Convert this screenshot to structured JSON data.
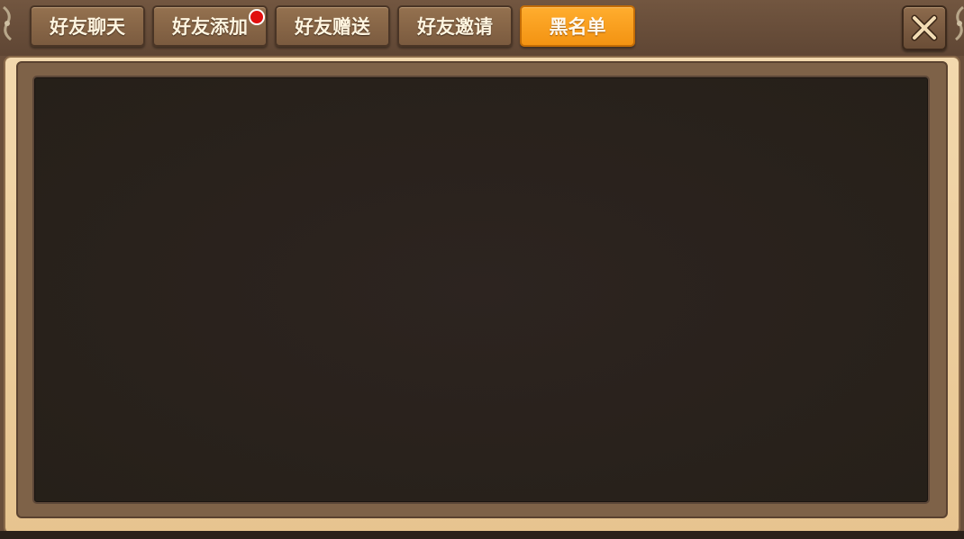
{
  "tabs": [
    {
      "label": "好友聊天",
      "active": false,
      "has_notification": false
    },
    {
      "label": "好友添加",
      "active": false,
      "has_notification": true
    },
    {
      "label": "好友赠送",
      "active": false,
      "has_notification": false
    },
    {
      "label": "好友邀请",
      "active": false,
      "has_notification": false
    },
    {
      "label": "黑名单",
      "active": true,
      "has_notification": false
    }
  ],
  "close_button": {
    "icon": "close-icon"
  },
  "colors": {
    "active_tab": "#f7a11f",
    "inactive_tab": "#86664a",
    "notification_dot": "#e10f0f",
    "content_background": "#2a221d",
    "frame_light": "#f0d3a5"
  }
}
